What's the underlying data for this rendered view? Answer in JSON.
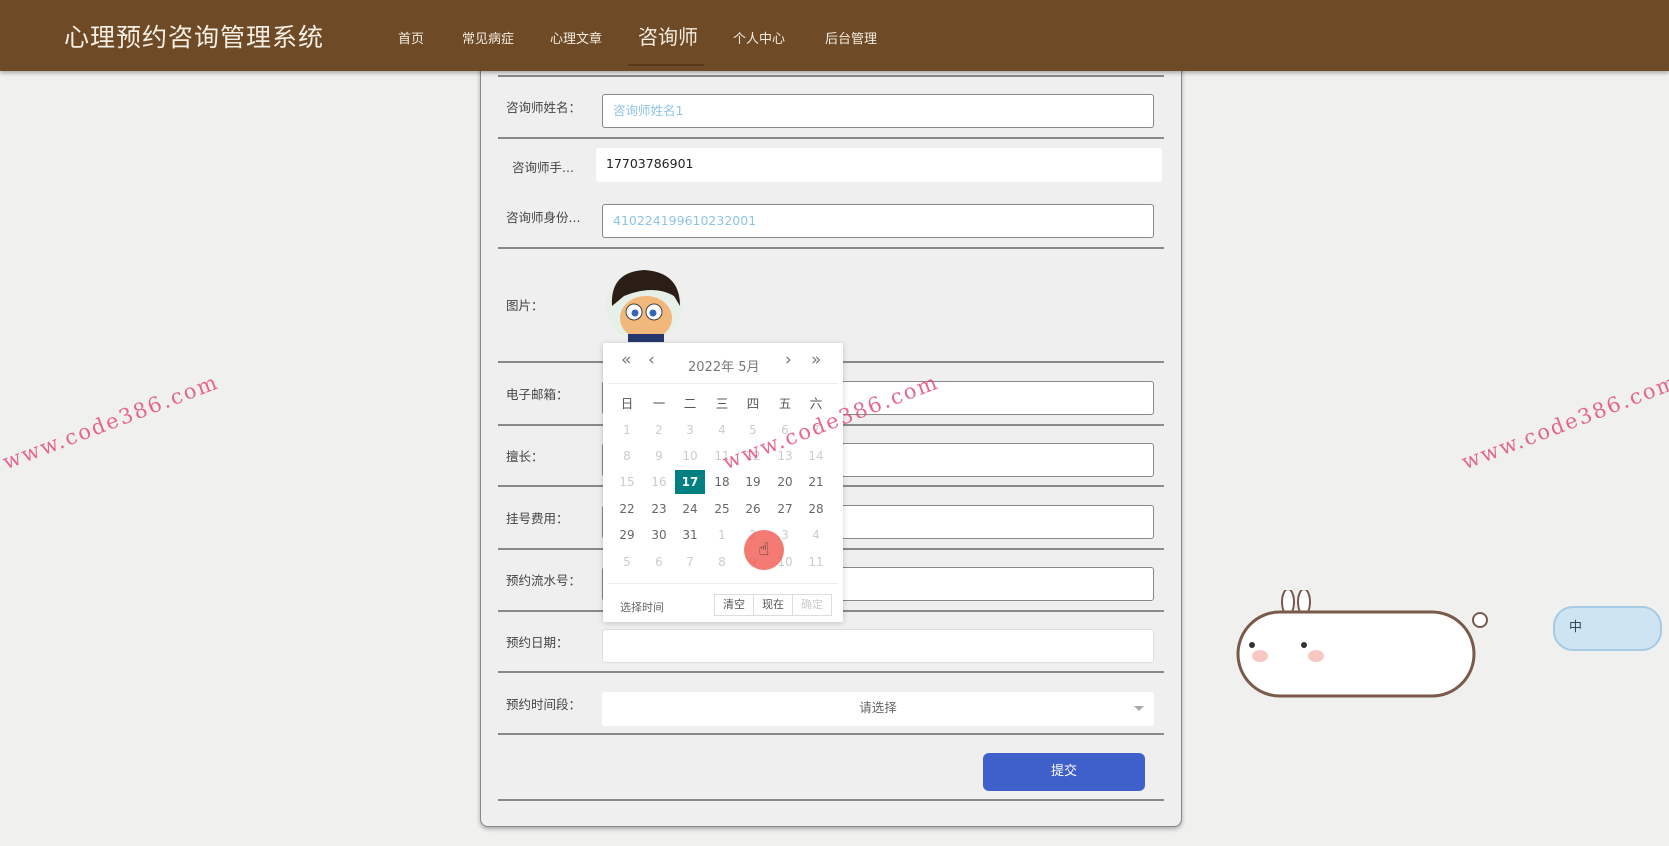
{
  "header": {
    "title": "心理预约咨询管理系统",
    "nav": [
      "首页",
      "常见病症",
      "心理文章",
      "咨询师",
      "个人中心",
      "后台管理"
    ],
    "active": "咨询师"
  },
  "form": {
    "name": {
      "label": "咨询师姓名：",
      "value": "咨询师姓名1"
    },
    "phone": {
      "label": "咨询师手...",
      "value": "17703786901"
    },
    "idcard": {
      "label": "咨询师身份...",
      "value": "410224199610232001"
    },
    "image": {
      "label": "图片："
    },
    "email": {
      "label": "电子邮箱："
    },
    "specialty": {
      "label": "擅长："
    },
    "fee": {
      "label": "挂号费用："
    },
    "serial": {
      "label": "预约流水号："
    },
    "date": {
      "label": "预约日期："
    },
    "timeslot": {
      "label": "预约时间段：",
      "placeholder": "请选择"
    },
    "submit": "提交"
  },
  "datepicker": {
    "title": "2022年  5月",
    "weekdays": [
      "日",
      "一",
      "二",
      "三",
      "四",
      "五",
      "六"
    ],
    "days": [
      [
        "1",
        "2",
        "3",
        "4",
        "5",
        "6",
        "7"
      ],
      [
        "8",
        "9",
        "10",
        "11",
        "12",
        "13",
        "14"
      ],
      [
        "15",
        "16",
        "17",
        "18",
        "19",
        "20",
        "21"
      ],
      [
        "22",
        "23",
        "24",
        "25",
        "26",
        "27",
        "28"
      ],
      [
        "29",
        "30",
        "31",
        "1",
        "2",
        "3",
        "4"
      ],
      [
        "5",
        "6",
        "7",
        "8",
        "9",
        "10",
        "11"
      ]
    ],
    "selected": "17",
    "select_time": "选择时间",
    "clear": "清空",
    "now": "现在",
    "confirm": "确定"
  },
  "watermark": "www.code386.com",
  "widget_label": "中",
  "colors": {
    "header": "#6e4a26",
    "submit": "#3f5fcb",
    "selected_day": "#008080"
  }
}
